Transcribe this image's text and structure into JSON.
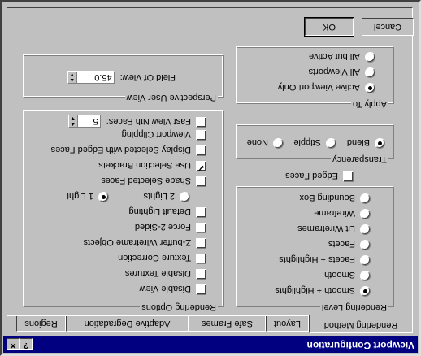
{
  "window": {
    "title": "Viewport Configuration",
    "help_glyph": "?",
    "close_glyph": "✕"
  },
  "tabs": [
    {
      "label": "Rendering Method",
      "active": true
    },
    {
      "label": "Layout"
    },
    {
      "label": "Safe Frames"
    },
    {
      "label": "Adaptive Degradation"
    },
    {
      "label": "Regions"
    }
  ],
  "rendering_level": {
    "title": "Rendering Level",
    "options": [
      {
        "label": "Smooth + Highlights",
        "selected": true
      },
      {
        "label": "Smooth"
      },
      {
        "label": "Facets + Highlights"
      },
      {
        "label": "Facets"
      },
      {
        "label": "Lit Wireframes"
      },
      {
        "label": "Wireframe"
      },
      {
        "label": "Bounding Box"
      }
    ],
    "edged_faces": {
      "label": "Edged Faces",
      "checked": false
    }
  },
  "transparency": {
    "title": "Transparency",
    "options": [
      {
        "label": "None"
      },
      {
        "label": "Stipple"
      },
      {
        "label": "Blend",
        "selected": true
      }
    ]
  },
  "apply_to": {
    "title": "Apply To",
    "options": [
      {
        "label": "Active Viewport Only",
        "selected": true
      },
      {
        "label": "All Viewports"
      },
      {
        "label": "All but Active"
      }
    ]
  },
  "rendering_options": {
    "title": "Rendering Options",
    "items": [
      {
        "label": "Disable View",
        "checked": false
      },
      {
        "label": "Disable Textures",
        "checked": false
      },
      {
        "label": "Texture Correction",
        "checked": false
      },
      {
        "label": "Z-buffer Wireframe Objects",
        "checked": false
      },
      {
        "label": "Force 2-Sided",
        "checked": false
      },
      {
        "label": "Default Lighting",
        "checked": false
      }
    ],
    "lights": [
      {
        "label": "1 Light",
        "selected": true
      },
      {
        "label": "2 Lights"
      }
    ],
    "items2": [
      {
        "label": "Shade Selected Faces",
        "checked": false
      },
      {
        "label": "Use Selection Brackets",
        "checked": true
      },
      {
        "label": "Display Selected with Edged Faces",
        "checked": false
      },
      {
        "label": "Viewport Clipping",
        "checked": false
      }
    ],
    "fast_view": {
      "label": "Fast View Nth Faces:",
      "checked": false,
      "value": "5"
    }
  },
  "perspective_user_view": {
    "title": "Perspective User View",
    "fov_label": "Field Of View:",
    "fov_value": "45.0"
  },
  "buttons": {
    "ok": "OK",
    "cancel": "Cancel"
  }
}
